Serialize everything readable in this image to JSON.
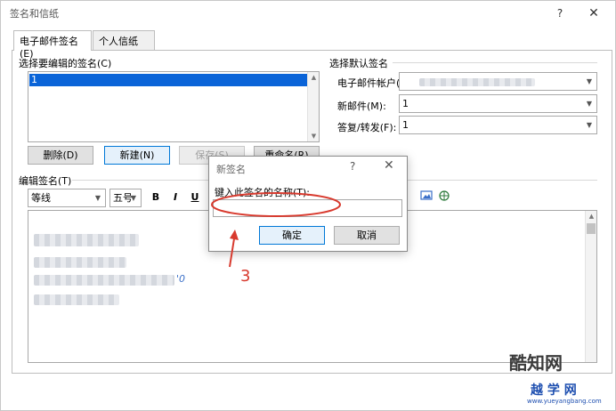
{
  "window": {
    "title": "签名和信纸",
    "help": "?",
    "close": "✕"
  },
  "tabs": [
    {
      "label": "电子邮件签名(E)",
      "active": true
    },
    {
      "label": "个人信纸(P)",
      "active": false
    }
  ],
  "edit_list": {
    "label": "选择要编辑的签名(C)",
    "items": [
      "1"
    ],
    "selected": "1"
  },
  "buttons": {
    "delete": "删除(D)",
    "new": "新建(N)",
    "save": "保存(S)",
    "rename": "重命名(R)"
  },
  "defaults": {
    "label": "选择默认签名",
    "account_label": "电子邮件帐户(A):",
    "new_messages_label": "新邮件(M):",
    "new_messages_value": "1",
    "reply_label": "答复/转发(F):",
    "reply_value": "1"
  },
  "editor": {
    "label": "编辑签名(T)",
    "font": "等线",
    "size": "五号",
    "bold": "B",
    "italic": "I",
    "underline": "U",
    "partial_text": "'0"
  },
  "new_signature_dialog": {
    "title": "新签名",
    "help": "?",
    "close": "✕",
    "prompt": "键入此签名的名称(T):",
    "input_value": "",
    "ok": "确定",
    "cancel": "取消"
  },
  "annotation": {
    "number": "3",
    "color": "#d83a2e"
  },
  "watermarks": {
    "brand1": "酷知网",
    "brand2": "越  学  网",
    "url": "www.yueyangbang.com"
  },
  "colors": {
    "selection": "#0a64d8",
    "focus": "#0078d7"
  }
}
